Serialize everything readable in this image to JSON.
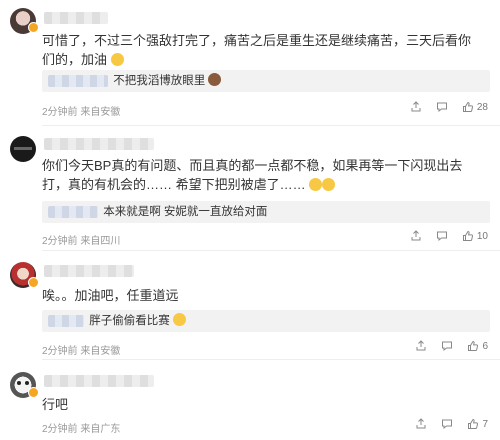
{
  "comments": [
    {
      "text": "可惜了，不过三个强敌打完了，痛苦之后是重生还是继续痛苦，三天后看你们的，加油",
      "reply": "不把我滔博放眼里",
      "meta": "2分钟前 来自安徽",
      "likes": "28"
    },
    {
      "text": "你们今天BP真的有问题、而且真的都一点都不稳，如果再等一下闪现出去打，真的有机会的…… 希望下把别被虐了……",
      "reply": "本来就是啊 安妮就一直放给对面",
      "meta": "2分钟前 来自四川",
      "likes": "10"
    },
    {
      "text": "唉。。加油吧，任重道远",
      "reply": "胖子偷偷看比赛",
      "meta": "2分钟前 来自安徽",
      "likes": "6"
    },
    {
      "text": "行吧",
      "meta": "2分钟前 来自广东",
      "likes": "7"
    }
  ],
  "icons": {
    "share": "share-icon",
    "comment": "comment-icon",
    "like": "thumbs-up-icon",
    "emoji": "emoji-icon"
  },
  "colors": {
    "badge": "#f5a623",
    "reply_bg": "#f2f2f2",
    "meta_text": "#999999"
  }
}
